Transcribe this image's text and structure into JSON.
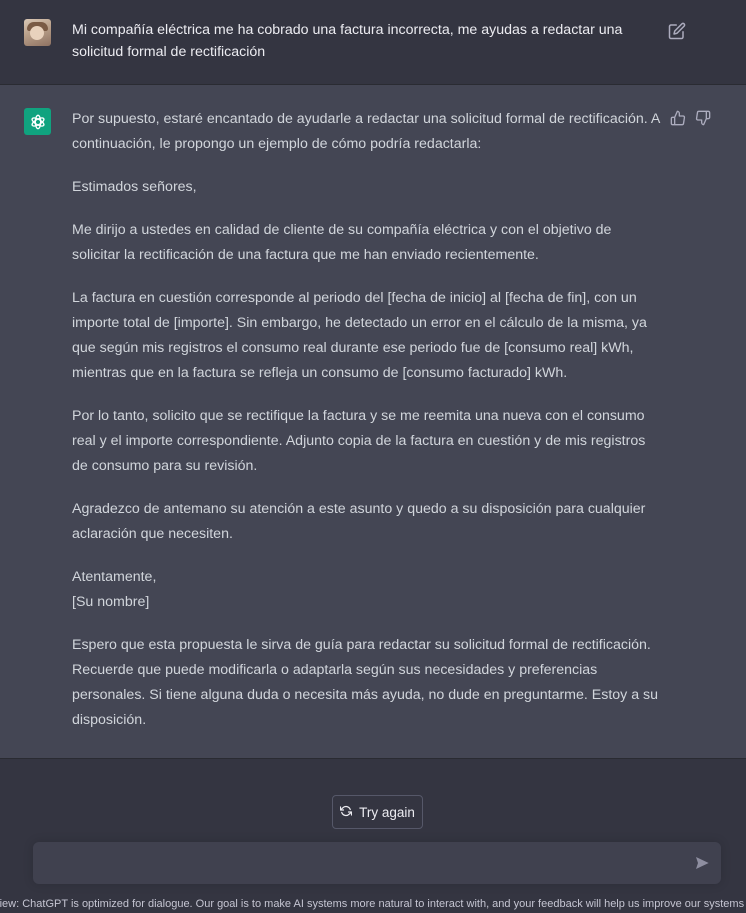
{
  "user_message": {
    "text": "Mi compañía eléctrica me ha cobrado una factura incorrecta, me ayudas a redactar una solicitud formal de rectificación",
    "avatar_icon": "user-avatar",
    "edit_icon": "edit-icon"
  },
  "assistant_message": {
    "logo_icon": "openai-logo",
    "paragraphs": [
      "Por supuesto, estaré encantado de ayudarle a redactar una solicitud formal de rectificación. A continuación, le propongo un ejemplo de cómo podría redactarla:",
      "Estimados señores,",
      "Me dirijo a ustedes en calidad de cliente de su compañía eléctrica y con el objetivo de solicitar la rectificación de una factura que me han enviado recientemente.",
      "La factura en cuestión corresponde al periodo del [fecha de inicio] al [fecha de fin], con un importe total de [importe]. Sin embargo, he detectado un error en el cálculo de la misma, ya que según mis registros el consumo real durante ese periodo fue de [consumo real] kWh, mientras que en la factura se refleja un consumo de [consumo facturado] kWh.",
      "Por lo tanto, solicito que se rectifique la factura y se me reemita una nueva con el consumo real y el importe correspondiente. Adjunto copia de la factura en cuestión y de mis registros de consumo para su revisión.",
      "Agradezco de antemano su atención a este asunto y quedo a su disposición para cualquier aclaración que necesiten.",
      "Atentamente,",
      "[Su nombre]",
      "Espero que esta propuesta le sirva de guía para redactar su solicitud formal de rectificación. Recuerde que puede modificarla o adaptarla según sus necesidades y preferencias personales. Si tiene alguna duda o necesita más ayuda, no dude en preguntarme. Estoy a su disposición."
    ]
  },
  "controls": {
    "try_again_label": "Try again",
    "input_value": "",
    "footer_text": "eview: ChatGPT is optimized for dialogue. Our goal is to make AI systems more natural to interact with, and your feedback will help us improve our systems ar"
  },
  "colors": {
    "background": "#343541",
    "assistant_background": "#444654",
    "input_background": "#40414f",
    "accent": "#10a37f"
  }
}
